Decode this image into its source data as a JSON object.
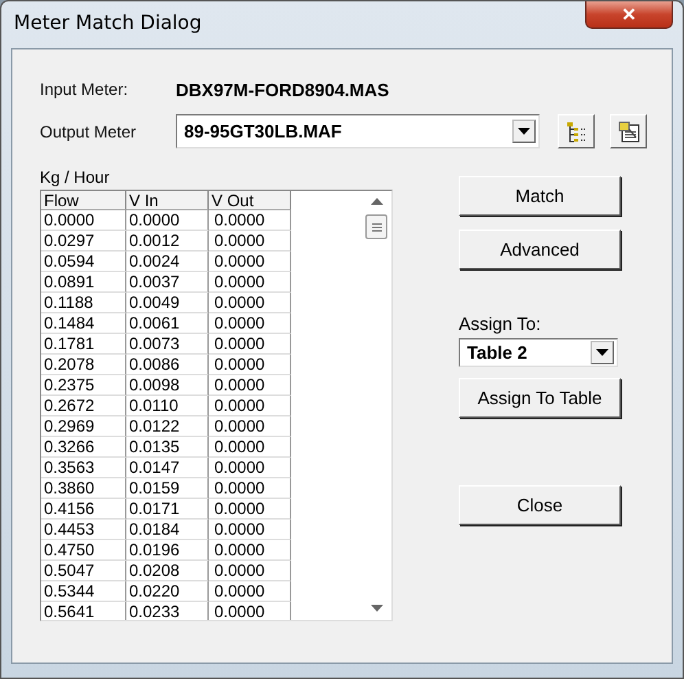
{
  "window": {
    "title": "Meter Match Dialog",
    "close": "✕"
  },
  "input_meter": {
    "label": "Input Meter:",
    "value": "DBX97M-FORD8904.MAS"
  },
  "output_meter": {
    "label": "Output Meter",
    "value": "89-95GT30LB.MAF"
  },
  "table": {
    "unit": "Kg / Hour",
    "columns": [
      "Flow",
      "V In",
      "V Out"
    ],
    "rows": [
      [
        "0.0000",
        "0.0000",
        "0.0000"
      ],
      [
        "0.0297",
        "0.0012",
        "0.0000"
      ],
      [
        "0.0594",
        "0.0024",
        "0.0000"
      ],
      [
        "0.0891",
        "0.0037",
        "0.0000"
      ],
      [
        "0.1188",
        "0.0049",
        "0.0000"
      ],
      [
        "0.1484",
        "0.0061",
        "0.0000"
      ],
      [
        "0.1781",
        "0.0073",
        "0.0000"
      ],
      [
        "0.2078",
        "0.0086",
        "0.0000"
      ],
      [
        "0.2375",
        "0.0098",
        "0.0000"
      ],
      [
        "0.2672",
        "0.0110",
        "0.0000"
      ],
      [
        "0.2969",
        "0.0122",
        "0.0000"
      ],
      [
        "0.3266",
        "0.0135",
        "0.0000"
      ],
      [
        "0.3563",
        "0.0147",
        "0.0000"
      ],
      [
        "0.3860",
        "0.0159",
        "0.0000"
      ],
      [
        "0.4156",
        "0.0171",
        "0.0000"
      ],
      [
        "0.4453",
        "0.0184",
        "0.0000"
      ],
      [
        "0.4750",
        "0.0196",
        "0.0000"
      ],
      [
        "0.5047",
        "0.0208",
        "0.0000"
      ],
      [
        "0.5344",
        "0.0220",
        "0.0000"
      ],
      [
        "0.5641",
        "0.0233",
        "0.0000"
      ]
    ]
  },
  "buttons_top": [
    "Match",
    "Advanced"
  ],
  "assign": {
    "label": "Assign To:",
    "value": "Table 2",
    "button": "Assign To Table"
  },
  "close_button": "Close"
}
